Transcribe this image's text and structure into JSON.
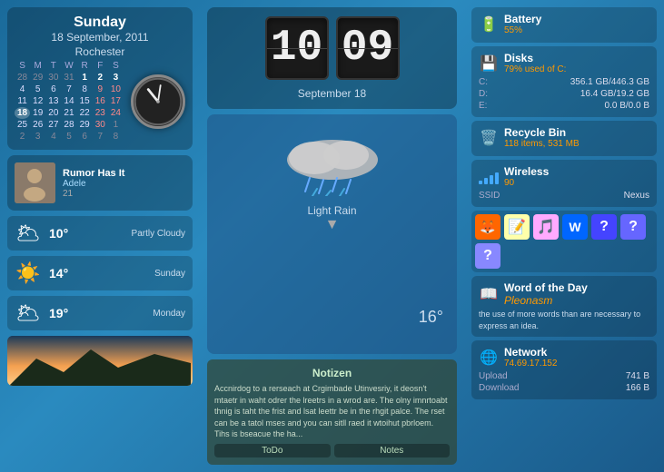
{
  "left": {
    "day": "Sunday",
    "date": "18 September, 2011",
    "city": "Rochester",
    "calendar": {
      "headers": [
        "S",
        "M",
        "T",
        "W",
        "R",
        "F",
        "S"
      ],
      "weeks": [
        [
          "28",
          "29",
          "30",
          "31",
          "1",
          "2",
          "3"
        ],
        [
          "4",
          "5",
          "6",
          "7",
          "8",
          "9",
          "10"
        ],
        [
          "11",
          "12",
          "13",
          "14",
          "15",
          "16",
          "17"
        ],
        [
          "18",
          "19",
          "20",
          "21",
          "22",
          "23",
          "24"
        ],
        [
          "25",
          "26",
          "27",
          "28",
          "29",
          "30",
          "1"
        ],
        [
          "2",
          "3",
          "4",
          "5",
          "6",
          "7",
          "8"
        ]
      ],
      "today_date": "18"
    },
    "now_playing": {
      "title": "Rumor Has It",
      "artist": "Adele",
      "track_num": "21"
    },
    "weather_forecast": [
      {
        "temp": "10°",
        "desc": "Partly Cloudy",
        "day": ""
      },
      {
        "temp": "14°",
        "desc": "",
        "day": "Sunday"
      },
      {
        "temp": "19°",
        "desc": "",
        "day": "Monday"
      }
    ]
  },
  "center": {
    "flip_clock": {
      "hour": "10",
      "minute": "09",
      "date": "September  18"
    },
    "weather_main": {
      "condition": "Light Rain",
      "temp": "16°"
    },
    "notizen": {
      "title": "Notizen",
      "text": "Accnirdog to a rerseach at Crgimbade Utinvesriy, it deosn't mtaetr in waht odrer the lreetrs in a wrod are. The olny imnrtoabt thnig is taht the frist and lsat leettr be in the rhgit palce.\n\nThe rset can be a tatol mses and you can sitll raed it wtoihut pbrloem. Tihs is bseacue the ha...",
      "todo_label": "ToDo",
      "notes_label": "Notes"
    }
  },
  "right": {
    "battery": {
      "title": "Battery",
      "percent": "55%",
      "icon": "🔋"
    },
    "disks": {
      "title": "Disks",
      "subtitle": "79% used of C:",
      "drives": [
        {
          "label": "C:",
          "value": "356.1 GB/446.3 GB"
        },
        {
          "label": "D:",
          "value": "16.4 GB/19.2 GB"
        },
        {
          "label": "E:",
          "value": "0.0 B/0.0 B"
        }
      ],
      "icon": "💾"
    },
    "recycle": {
      "title": "Recycle Bin",
      "subtitle": "118  items, 531 MB",
      "icon": "🗑️"
    },
    "wireless": {
      "title": "Wireless",
      "value": "90",
      "ssid_label": "SSID",
      "ssid_value": "Nexus",
      "icon": "📶"
    },
    "quick_launch": {
      "icons": [
        "🦊",
        "📝",
        "🎵",
        "W",
        "❓",
        "❓",
        "❓"
      ]
    },
    "word_of_day": {
      "title": "Word of the Day",
      "word": "Pleonasm",
      "definition": "the use of more words than are necessary to express an idea.",
      "icon": "📖"
    },
    "network": {
      "title": "Network",
      "ip": "74.69.17.152",
      "upload_label": "Upload",
      "upload_value": "741 B",
      "download_label": "Download",
      "download_value": "166 B",
      "icon": "🌐"
    }
  },
  "icons": {
    "battery": "🔋",
    "disk": "💿",
    "recycle": "♻",
    "wireless": "📶",
    "book": "📖",
    "globe": "🌐",
    "cloud": "☁",
    "sun": "☀",
    "rain": "🌧"
  }
}
